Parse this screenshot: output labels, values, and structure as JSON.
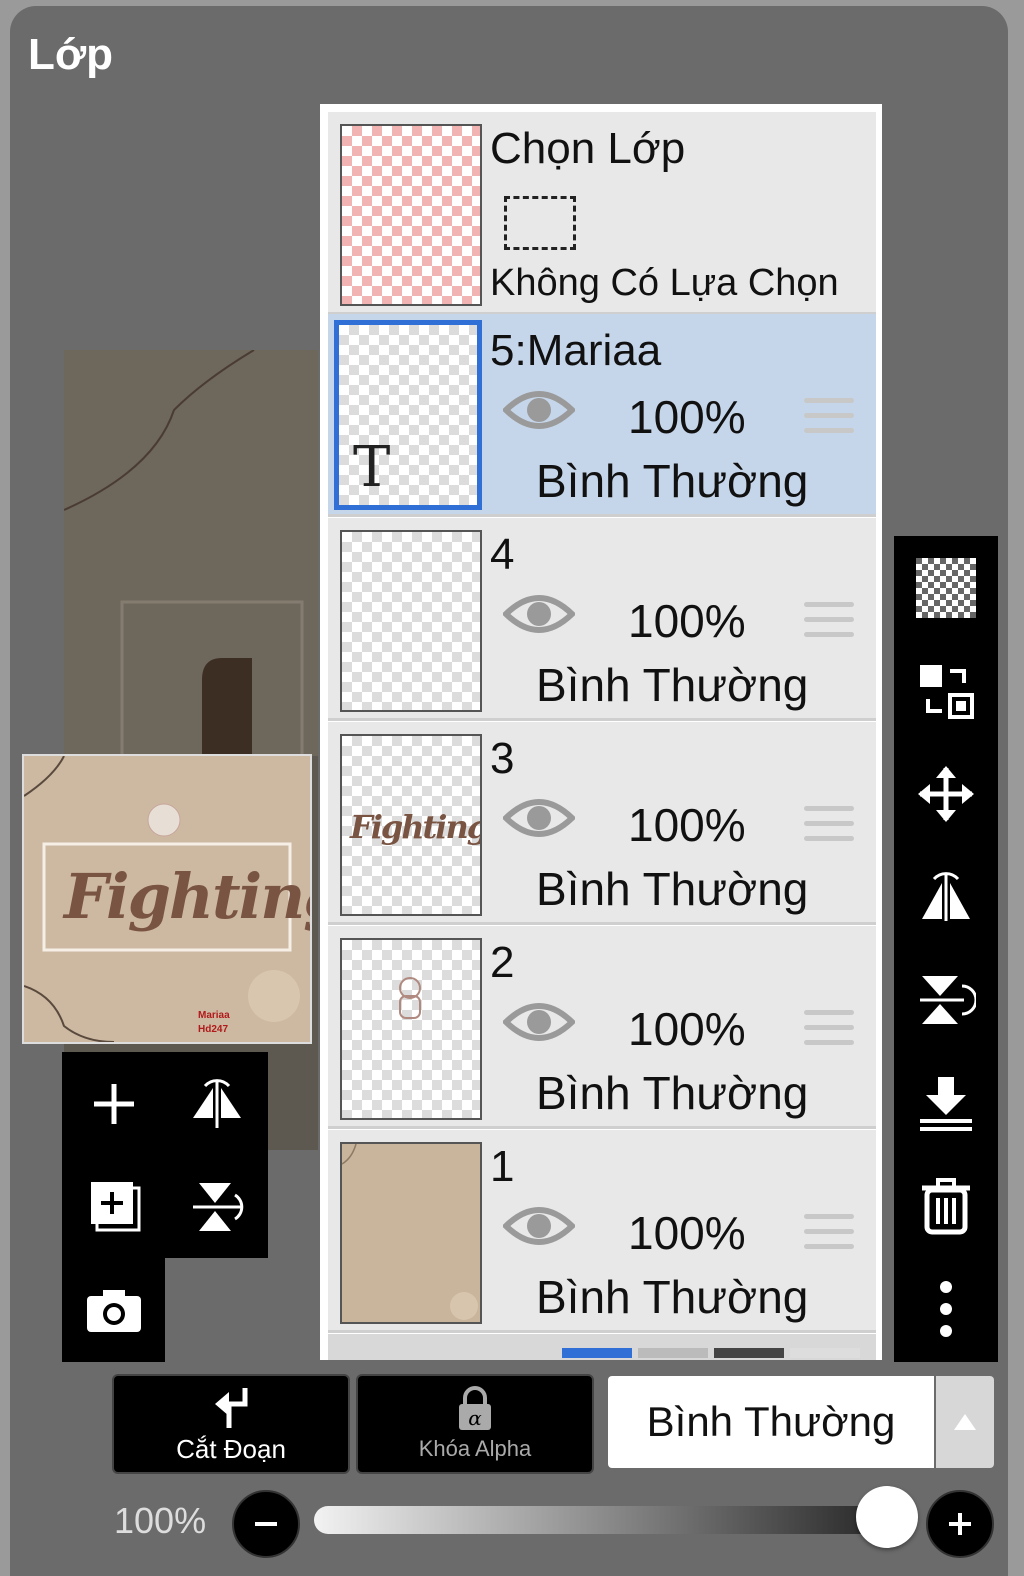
{
  "panel": {
    "title": "Lớp"
  },
  "selection_layer": {
    "title": "Chọn Lớp",
    "status": "Không Có Lựa Chọn"
  },
  "layers": [
    {
      "name": "5:Mariaa",
      "opacity": "100%",
      "blend": "Bình Thường",
      "selected": true,
      "thumb_glyph": "T"
    },
    {
      "name": "4",
      "opacity": "100%",
      "blend": "Bình Thường"
    },
    {
      "name": "3",
      "opacity": "100%",
      "blend": "Bình Thường",
      "thumb_text": "Fighting"
    },
    {
      "name": "2",
      "opacity": "100%",
      "blend": "Bình Thường"
    },
    {
      "name": "1",
      "opacity": "100%",
      "blend": "Bình Thường"
    }
  ],
  "preview": {
    "art_text": "Fighting",
    "small_text_1": "Mariaa",
    "small_text_2": "Hd247"
  },
  "left_tools": [
    "add-layer-icon",
    "flip-horizontal-icon",
    "duplicate-layer-icon",
    "flip-vertical-icon",
    "camera-icon"
  ],
  "right_tools": [
    "transparency-icon",
    "swap-icon",
    "move-icon",
    "flip-horizontal-icon",
    "flip-vertical-icon",
    "merge-down-icon",
    "trash-icon",
    "more-icon"
  ],
  "bottom": {
    "clip_label": "Cắt Đoạn",
    "alpha_lock_label": "Khóa Alpha",
    "blend_mode": "Bình Thường",
    "opacity_label": "100%",
    "opacity_value": 1.0
  },
  "colors": {
    "selected_layer": "#c6d6ea",
    "accent": "#2f6fd6"
  }
}
